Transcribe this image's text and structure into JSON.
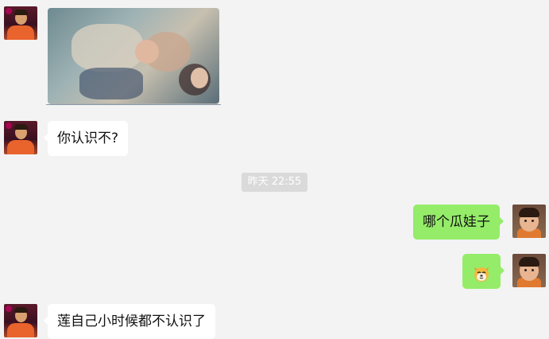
{
  "messages": [
    {
      "id": "m1",
      "side": "left",
      "type": "image"
    },
    {
      "id": "m2",
      "side": "left",
      "type": "text",
      "text": "你认识不?"
    },
    {
      "id": "m3",
      "side": "right",
      "type": "text",
      "text": "哪个瓜娃子"
    },
    {
      "id": "m4",
      "side": "right",
      "type": "emoji",
      "icon": "dog-face-icon"
    },
    {
      "id": "m5",
      "side": "left",
      "type": "text",
      "text": "莲自己小时候都不认识了"
    }
  ],
  "timestamp": "昨天 22:55",
  "colors": {
    "background": "#f3f3f3",
    "incoming_bubble": "#ffffff",
    "outgoing_bubble": "#95ec69",
    "timestamp_bg": "#dadada"
  }
}
